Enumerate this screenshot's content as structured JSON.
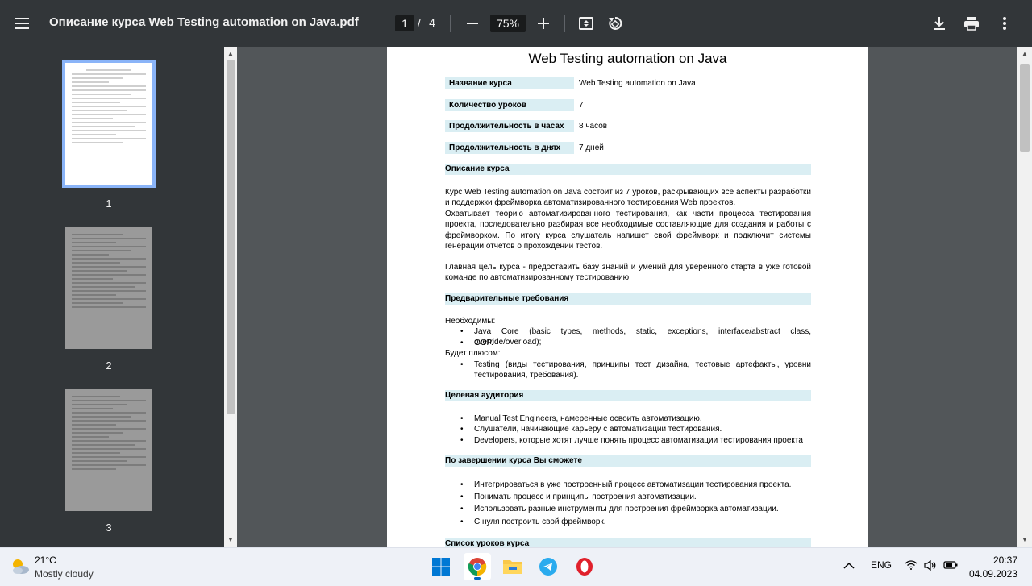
{
  "toolbar": {
    "title": "Описание курса Web Testing automation on Java.pdf",
    "page_current": "1",
    "page_separator": "/",
    "page_total": "4",
    "zoom": "75%"
  },
  "sidebar": {
    "thumbnails": [
      {
        "label": "1"
      },
      {
        "label": "2"
      },
      {
        "label": "3"
      }
    ]
  },
  "document": {
    "title": "Web Testing automation on Java",
    "info": [
      {
        "label": "Название курса",
        "value": "Web Testing automation on Java"
      },
      {
        "label": "Количество уроков",
        "value": "7"
      },
      {
        "label": "Продолжительность в часах",
        "value": "8 часов"
      },
      {
        "label": "Продолжительность в днях",
        "value": "7 дней"
      }
    ],
    "sections": {
      "description": "Описание курса",
      "prerequisites": "Предварительные требования",
      "audience": "Целевая аудитория",
      "outcomes": "По завершении курса Вы сможете",
      "lessons": "Список уроков курса"
    },
    "description_p1": "Курс Web Testing automation on Java состоит из 7 уроков, раскрывающих все аспекты разработки и поддержки фреймворка автоматизированного тестирования Web проектов.",
    "description_p2": "Охватывает теорию автоматизированного тестирования, как части процесса тестирования проекта, последовательно разбирая все необходимые составляющие для создания и работы с фреймворком. По итогу курса слушатель напишет свой фреймворк и подключит системы генерации отчетов о прохождении тестов.",
    "description_p3": "Главная цель курса - предоставить базу знаний и умений для уверенного старта в уже готовой команде по автоматизированному тестированию.",
    "required_label": "Необходимы:",
    "required_items": [
      "Java Core (basic types, methods, static, exceptions, interface/abstract class, override/overload);",
      "OOP."
    ],
    "plus_label": "Будет плюсом:",
    "plus_items": [
      "Testing (виды тестирования, принципы тест дизайна, тестовые артефакты, уровни тестирования, требования)."
    ],
    "audience_items": [
      "Manual Test Engineers, намеренные освоить автоматизацию.",
      "Слушатели, начинающие карьеру с автоматизации тестирования.",
      "Developers, которые хотят лучше понять процесс автоматизации тестирования проекта"
    ],
    "outcome_items": [
      "Интегрироваться в уже построенный процесс автоматизации тестирования проекта.",
      "Понимать процесс и принципы построения автоматизации.",
      "Использовать разные инструменты для построения фреймворка автоматизации.",
      "С нуля построить свой фреймворк."
    ]
  },
  "taskbar": {
    "temperature": "21°C",
    "weather": "Mostly cloudy",
    "language": "ENG",
    "time": "20:37",
    "date": "04.09.2023",
    "apps": [
      "windows-start",
      "chrome",
      "file-explorer",
      "telegram",
      "opera"
    ]
  },
  "colors": {
    "toolbar_bg": "#323639",
    "viewer_bg": "#525659",
    "section_bg": "#daeef3",
    "thumb_highlight": "#8ab4f8",
    "taskbar_bg": "#eef1f7"
  }
}
